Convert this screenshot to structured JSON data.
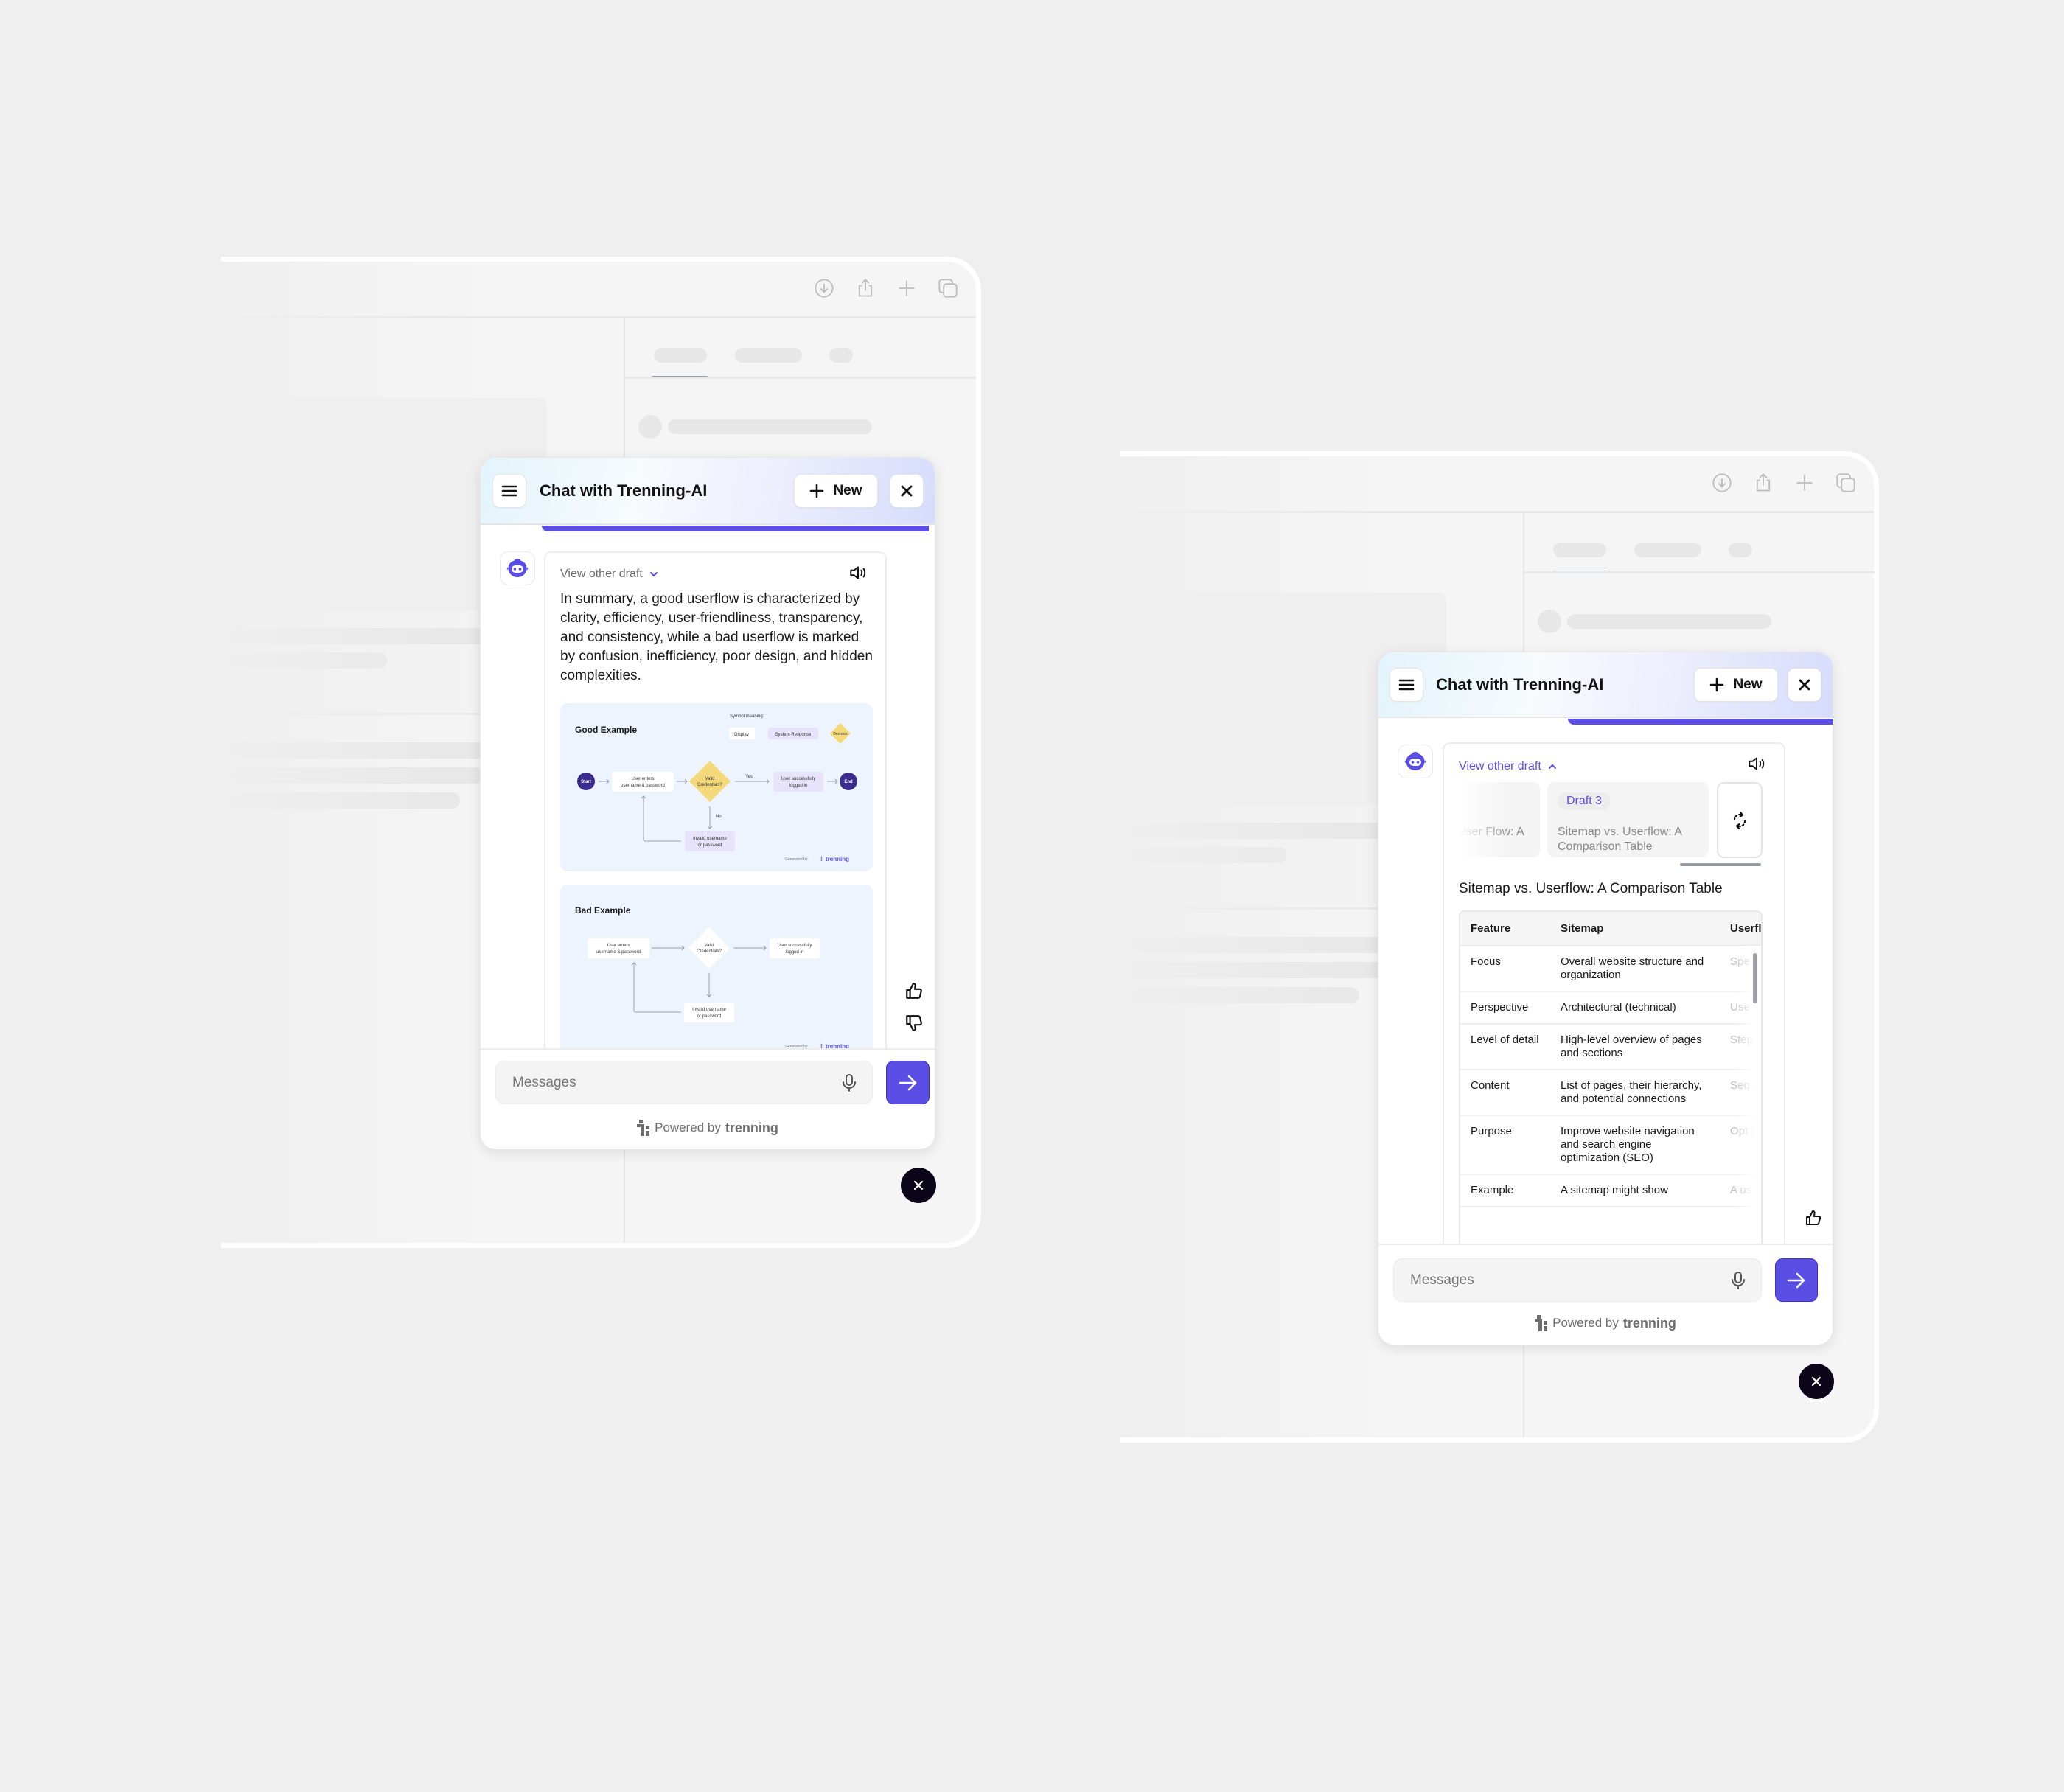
{
  "browser_toolbar": {
    "icons": [
      "download-icon",
      "share-icon",
      "plus-icon",
      "tabs-icon"
    ]
  },
  "chat_left": {
    "header": {
      "title": "Chat with Trenning-AI",
      "new_label": "New",
      "close_label": "✕"
    },
    "progress_fraction": 0.85,
    "message": {
      "view_other_draft": "View other draft",
      "text": "In summary, a good userflow is characterized by clarity, efficiency, user-friendliness, transparency, and consistency, while a bad userflow is marked by confusion, inefficiency, poor design, and hidden complexities."
    },
    "good_example": {
      "title": "Good Example",
      "legend_title": "Symbol meaning:",
      "legend": [
        "Display",
        "System Response",
        "Decision"
      ],
      "start": "Start",
      "end": "End",
      "step1": [
        "User enters",
        "username & password"
      ],
      "decision": [
        "Valid",
        "Credentials?"
      ],
      "yes": "Yes",
      "no": "No",
      "success": [
        "User successfully",
        "logged in"
      ],
      "invalid": [
        "Invalid username",
        "or password"
      ],
      "generated_by": "Generated by:",
      "brand": "trenning"
    },
    "bad_example": {
      "title": "Bad Example",
      "step1": [
        "User enters",
        "username & password"
      ],
      "decision": [
        "Valid",
        "Credentials?"
      ],
      "success": [
        "User successfully",
        "logged in"
      ],
      "invalid": [
        "Invalid username",
        "or password"
      ],
      "generated_by": "Generated by:",
      "brand": "trenning"
    },
    "input": {
      "placeholder": "Messages"
    },
    "powered_by": "Powered by",
    "powered_brand": "trenning",
    "fab_label": "✕"
  },
  "chat_right": {
    "header": {
      "title": "Chat with Trenning-AI",
      "new_label": "New",
      "close_label": "✕"
    },
    "progress_fraction": 0.55,
    "message": {
      "view_other_draft": "View other draft",
      "drafts": [
        {
          "label": "",
          "title": "User Flow: A"
        },
        {
          "label": "Draft 3",
          "title": "Sitemap vs. Userflow: A Comparison Table"
        }
      ],
      "table_title": "Sitemap vs. Userflow: A Comparison Table",
      "table": {
        "headers": [
          "Feature",
          "Sitemap",
          "Userflow"
        ],
        "rows": [
          [
            "Focus",
            "Overall website structure and organization",
            "Spe con"
          ],
          [
            "Perspective",
            "Architectural (technical)",
            "Use"
          ],
          [
            "Level of detail",
            "High-level overview of pages and sections",
            "Step dec"
          ],
          [
            "Content",
            "List of pages, their hierarchy, and potential connections",
            "Seq acti poin"
          ],
          [
            "Purpose",
            "Improve website navigation and search engine optimization (SEO)",
            "Opt (UX) goa"
          ],
          [
            "Example",
            "A sitemap might show",
            "A us"
          ]
        ]
      }
    },
    "input": {
      "placeholder": "Messages"
    },
    "powered_by": "Powered by",
    "powered_brand": "trenning",
    "fab_label": "✕"
  },
  "colors": {
    "accent": "#5a4ee4",
    "decision": "#f3d97a",
    "start_end": "#3b2d8f",
    "diagram_bg": "#eef4fe",
    "fab": "#0a0518"
  }
}
